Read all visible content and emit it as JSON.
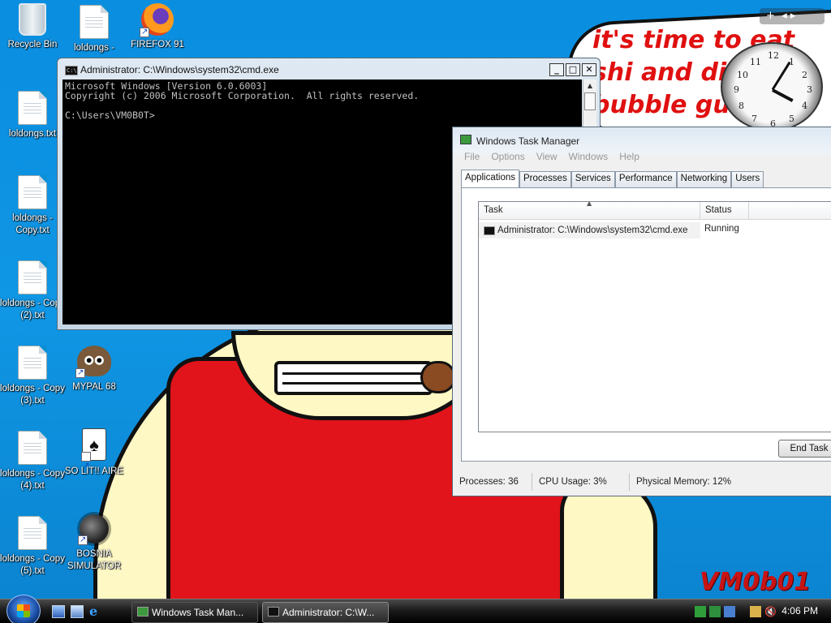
{
  "wallpaper": {
    "speech_text": "it's time to eat shi and die ar bubble gu",
    "watermark": "VM0b01"
  },
  "desktop_icons": [
    {
      "label": "Recycle Bin",
      "icon": "recycle-bin-icon"
    },
    {
      "label": "loldongs -",
      "icon": "text-file-icon"
    },
    {
      "label": "FIREFOX 91",
      "icon": "firefox-icon"
    },
    {
      "label": "loldongs.txt",
      "icon": "text-file-icon"
    },
    {
      "label": "loldongs - Copy.txt",
      "icon": "text-file-icon"
    },
    {
      "label": "loldongs - Copy (2).txt",
      "icon": "text-file-icon"
    },
    {
      "label": "loldongs - Copy (3).txt",
      "icon": "text-file-icon"
    },
    {
      "label": "MYPAL 68",
      "icon": "mypal-icon"
    },
    {
      "label": "loldongs - Copy (4).txt",
      "icon": "text-file-icon"
    },
    {
      "label": "SO LIT!! AIRE",
      "icon": "solitaire-icon"
    },
    {
      "label": "loldongs - Copy (5).txt",
      "icon": "text-file-icon"
    },
    {
      "label": "BOSNIA SIMULATOR",
      "icon": "minesweeper-icon"
    }
  ],
  "gadget": {
    "clock_numbers": [
      "12",
      "1",
      "2",
      "3",
      "4",
      "5",
      "6",
      "7",
      "8",
      "9",
      "10",
      "11"
    ]
  },
  "cmd_window": {
    "title": "Administrator: C:\\Windows\\system32\\cmd.exe",
    "console_text": "Microsoft Windows [Version 6.0.6003]\nCopyright (c) 2006 Microsoft Corporation.  All rights reserved.\n\nC:\\Users\\VM0B0T>"
  },
  "task_manager": {
    "title": "Windows Task Manager",
    "menu": [
      "File",
      "Options",
      "View",
      "Windows",
      "Help"
    ],
    "tabs": [
      "Applications",
      "Processes",
      "Services",
      "Performance",
      "Networking",
      "Users"
    ],
    "active_tab": "Applications",
    "columns": [
      "Task",
      "Status"
    ],
    "rows": [
      {
        "task": "Administrator: C:\\Windows\\system32\\cmd.exe",
        "status": "Running"
      }
    ],
    "end_task_label": "End Task",
    "status": {
      "processes": "Processes: 36",
      "cpu": "CPU Usage: 3%",
      "memory": "Physical Memory: 12%"
    }
  },
  "taskbar": {
    "buttons": [
      "Windows Task Man...",
      "Administrator: C:\\W..."
    ],
    "time": "4:06 PM"
  },
  "colors": {
    "desktop": "#0a8fd6",
    "console_bg": "#000000",
    "console_fg": "#c0c0c0"
  }
}
